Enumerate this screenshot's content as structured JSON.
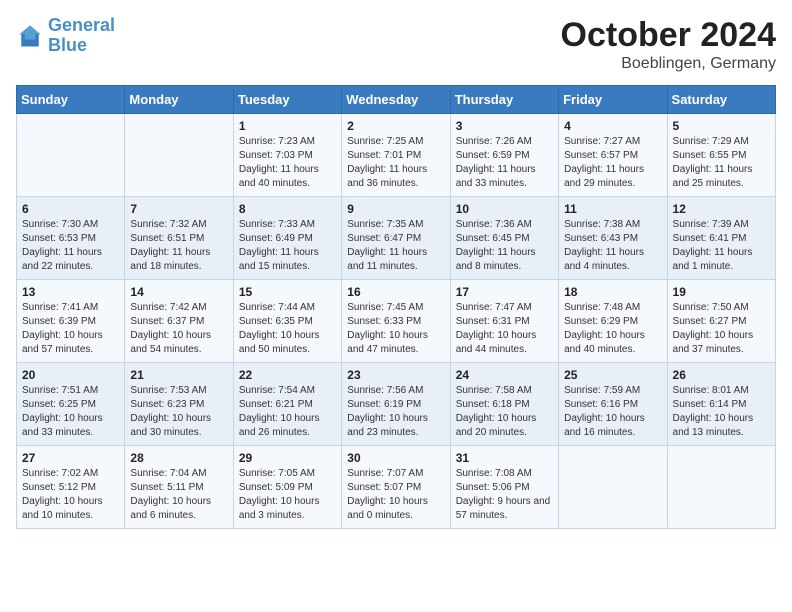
{
  "logo": {
    "name_part1": "General",
    "name_part2": "Blue"
  },
  "header": {
    "month": "October 2024",
    "location": "Boeblingen, Germany"
  },
  "days_of_week": [
    "Sunday",
    "Monday",
    "Tuesday",
    "Wednesday",
    "Thursday",
    "Friday",
    "Saturday"
  ],
  "weeks": [
    [
      {
        "date": "",
        "sunrise": "",
        "sunset": "",
        "daylight": ""
      },
      {
        "date": "",
        "sunrise": "",
        "sunset": "",
        "daylight": ""
      },
      {
        "date": "1",
        "sunrise": "Sunrise: 7:23 AM",
        "sunset": "Sunset: 7:03 PM",
        "daylight": "Daylight: 11 hours and 40 minutes."
      },
      {
        "date": "2",
        "sunrise": "Sunrise: 7:25 AM",
        "sunset": "Sunset: 7:01 PM",
        "daylight": "Daylight: 11 hours and 36 minutes."
      },
      {
        "date": "3",
        "sunrise": "Sunrise: 7:26 AM",
        "sunset": "Sunset: 6:59 PM",
        "daylight": "Daylight: 11 hours and 33 minutes."
      },
      {
        "date": "4",
        "sunrise": "Sunrise: 7:27 AM",
        "sunset": "Sunset: 6:57 PM",
        "daylight": "Daylight: 11 hours and 29 minutes."
      },
      {
        "date": "5",
        "sunrise": "Sunrise: 7:29 AM",
        "sunset": "Sunset: 6:55 PM",
        "daylight": "Daylight: 11 hours and 25 minutes."
      }
    ],
    [
      {
        "date": "6",
        "sunrise": "Sunrise: 7:30 AM",
        "sunset": "Sunset: 6:53 PM",
        "daylight": "Daylight: 11 hours and 22 minutes."
      },
      {
        "date": "7",
        "sunrise": "Sunrise: 7:32 AM",
        "sunset": "Sunset: 6:51 PM",
        "daylight": "Daylight: 11 hours and 18 minutes."
      },
      {
        "date": "8",
        "sunrise": "Sunrise: 7:33 AM",
        "sunset": "Sunset: 6:49 PM",
        "daylight": "Daylight: 11 hours and 15 minutes."
      },
      {
        "date": "9",
        "sunrise": "Sunrise: 7:35 AM",
        "sunset": "Sunset: 6:47 PM",
        "daylight": "Daylight: 11 hours and 11 minutes."
      },
      {
        "date": "10",
        "sunrise": "Sunrise: 7:36 AM",
        "sunset": "Sunset: 6:45 PM",
        "daylight": "Daylight: 11 hours and 8 minutes."
      },
      {
        "date": "11",
        "sunrise": "Sunrise: 7:38 AM",
        "sunset": "Sunset: 6:43 PM",
        "daylight": "Daylight: 11 hours and 4 minutes."
      },
      {
        "date": "12",
        "sunrise": "Sunrise: 7:39 AM",
        "sunset": "Sunset: 6:41 PM",
        "daylight": "Daylight: 11 hours and 1 minute."
      }
    ],
    [
      {
        "date": "13",
        "sunrise": "Sunrise: 7:41 AM",
        "sunset": "Sunset: 6:39 PM",
        "daylight": "Daylight: 10 hours and 57 minutes."
      },
      {
        "date": "14",
        "sunrise": "Sunrise: 7:42 AM",
        "sunset": "Sunset: 6:37 PM",
        "daylight": "Daylight: 10 hours and 54 minutes."
      },
      {
        "date": "15",
        "sunrise": "Sunrise: 7:44 AM",
        "sunset": "Sunset: 6:35 PM",
        "daylight": "Daylight: 10 hours and 50 minutes."
      },
      {
        "date": "16",
        "sunrise": "Sunrise: 7:45 AM",
        "sunset": "Sunset: 6:33 PM",
        "daylight": "Daylight: 10 hours and 47 minutes."
      },
      {
        "date": "17",
        "sunrise": "Sunrise: 7:47 AM",
        "sunset": "Sunset: 6:31 PM",
        "daylight": "Daylight: 10 hours and 44 minutes."
      },
      {
        "date": "18",
        "sunrise": "Sunrise: 7:48 AM",
        "sunset": "Sunset: 6:29 PM",
        "daylight": "Daylight: 10 hours and 40 minutes."
      },
      {
        "date": "19",
        "sunrise": "Sunrise: 7:50 AM",
        "sunset": "Sunset: 6:27 PM",
        "daylight": "Daylight: 10 hours and 37 minutes."
      }
    ],
    [
      {
        "date": "20",
        "sunrise": "Sunrise: 7:51 AM",
        "sunset": "Sunset: 6:25 PM",
        "daylight": "Daylight: 10 hours and 33 minutes."
      },
      {
        "date": "21",
        "sunrise": "Sunrise: 7:53 AM",
        "sunset": "Sunset: 6:23 PM",
        "daylight": "Daylight: 10 hours and 30 minutes."
      },
      {
        "date": "22",
        "sunrise": "Sunrise: 7:54 AM",
        "sunset": "Sunset: 6:21 PM",
        "daylight": "Daylight: 10 hours and 26 minutes."
      },
      {
        "date": "23",
        "sunrise": "Sunrise: 7:56 AM",
        "sunset": "Sunset: 6:19 PM",
        "daylight": "Daylight: 10 hours and 23 minutes."
      },
      {
        "date": "24",
        "sunrise": "Sunrise: 7:58 AM",
        "sunset": "Sunset: 6:18 PM",
        "daylight": "Daylight: 10 hours and 20 minutes."
      },
      {
        "date": "25",
        "sunrise": "Sunrise: 7:59 AM",
        "sunset": "Sunset: 6:16 PM",
        "daylight": "Daylight: 10 hours and 16 minutes."
      },
      {
        "date": "26",
        "sunrise": "Sunrise: 8:01 AM",
        "sunset": "Sunset: 6:14 PM",
        "daylight": "Daylight: 10 hours and 13 minutes."
      }
    ],
    [
      {
        "date": "27",
        "sunrise": "Sunrise: 7:02 AM",
        "sunset": "Sunset: 5:12 PM",
        "daylight": "Daylight: 10 hours and 10 minutes."
      },
      {
        "date": "28",
        "sunrise": "Sunrise: 7:04 AM",
        "sunset": "Sunset: 5:11 PM",
        "daylight": "Daylight: 10 hours and 6 minutes."
      },
      {
        "date": "29",
        "sunrise": "Sunrise: 7:05 AM",
        "sunset": "Sunset: 5:09 PM",
        "daylight": "Daylight: 10 hours and 3 minutes."
      },
      {
        "date": "30",
        "sunrise": "Sunrise: 7:07 AM",
        "sunset": "Sunset: 5:07 PM",
        "daylight": "Daylight: 10 hours and 0 minutes."
      },
      {
        "date": "31",
        "sunrise": "Sunrise: 7:08 AM",
        "sunset": "Sunset: 5:06 PM",
        "daylight": "Daylight: 9 hours and 57 minutes."
      },
      {
        "date": "",
        "sunrise": "",
        "sunset": "",
        "daylight": ""
      },
      {
        "date": "",
        "sunrise": "",
        "sunset": "",
        "daylight": ""
      }
    ]
  ]
}
